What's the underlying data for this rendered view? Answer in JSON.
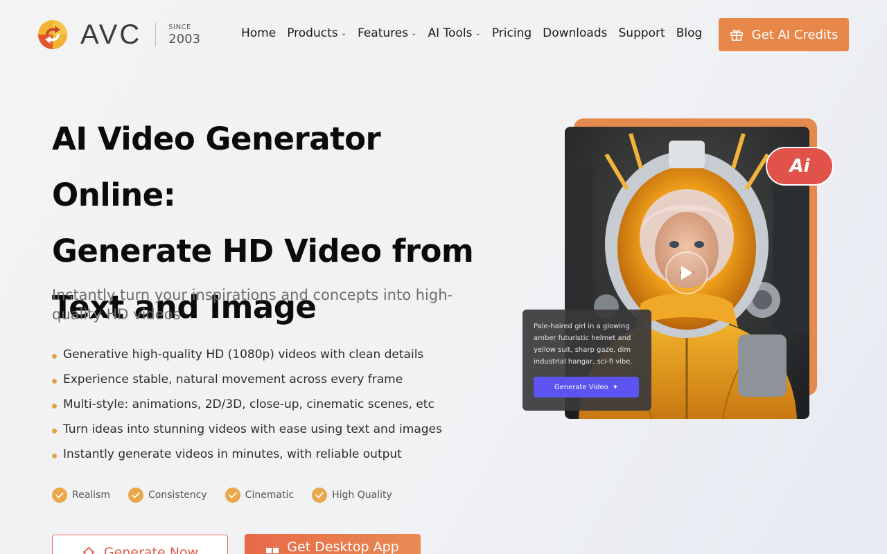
{
  "brand": {
    "name": "AVC",
    "since_label": "SINCE",
    "since_year": "2003",
    "logo_icon": "avc-refresh-arrows-icon"
  },
  "nav": {
    "items": [
      {
        "label": "Home",
        "has_dropdown": false
      },
      {
        "label": "Products",
        "has_dropdown": true
      },
      {
        "label": "Features",
        "has_dropdown": true
      },
      {
        "label": "AI Tools",
        "has_dropdown": true
      },
      {
        "label": "Pricing",
        "has_dropdown": false
      },
      {
        "label": "Downloads",
        "has_dropdown": false
      },
      {
        "label": "Support",
        "has_dropdown": false
      },
      {
        "label": "Blog",
        "has_dropdown": false
      }
    ],
    "cta_label": "Get AI Credits",
    "cta_icon": "gift-icon"
  },
  "hero": {
    "title_line1": "AI Video Generator Online:",
    "title_line2": "Generate HD Video from",
    "title_line3": "Text and Image",
    "subtitle": "Instantly turn your inspirations and concepts into high-quality HD videos",
    "bullets": [
      "Generative high-quality HD (1080p) videos with clean details",
      "Experience stable, natural movement across every frame",
      "Multi-style: animations, 2D/3D, close-up, cinematic scenes, etc",
      "Turn ideas into stunning videos with ease using text and images",
      "Instantly generate videos in minutes, with reliable output"
    ],
    "features": [
      "Realism",
      "Consistency",
      "Cinematic",
      "High Quality"
    ],
    "primary_button": "Generate Now",
    "secondary_button": "Get Desktop App"
  },
  "preview": {
    "badge": "Ai",
    "prompt": "Pale-haired girl in a glowing amber futuristic helmet and yellow suit, sharp gaze, dim industrial hangar, sci-fi vibe.",
    "prompt_button": "Generate Video"
  },
  "colors": {
    "accent_orange": "#e8874a",
    "bullet_gold": "#e0a43c",
    "generate_blue": "#5b54f0",
    "ai_red": "#e0524a"
  }
}
